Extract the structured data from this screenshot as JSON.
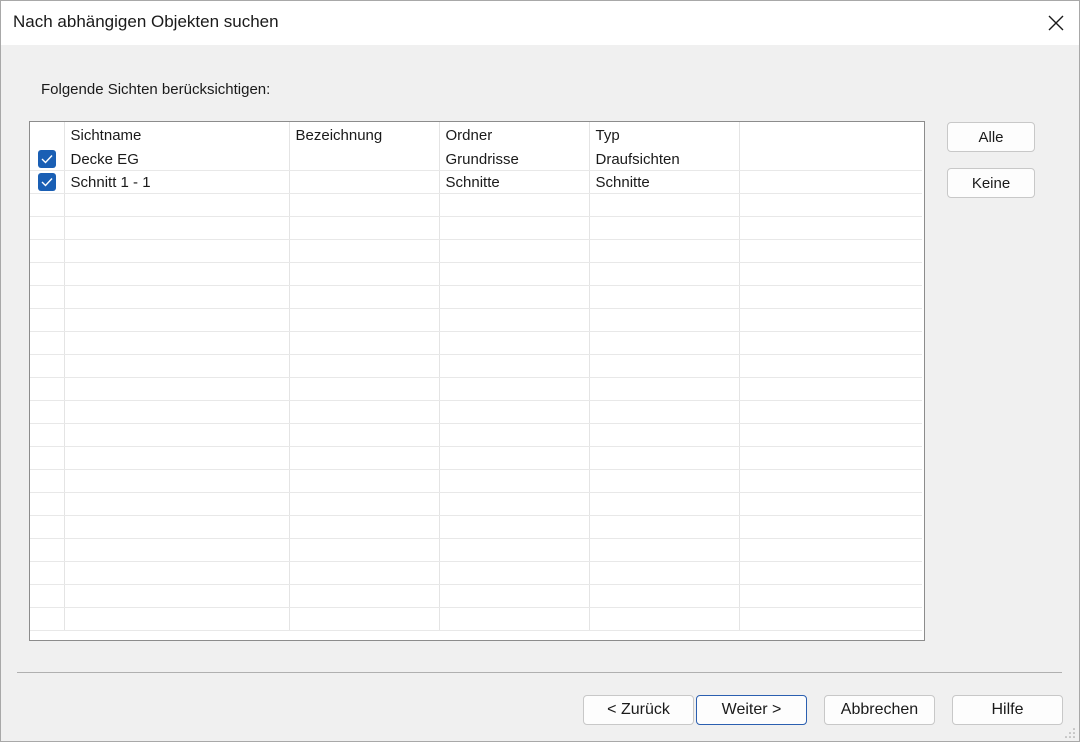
{
  "window": {
    "title": "Nach abhängigen Objekten suchen",
    "close_icon": "close-icon"
  },
  "prompt": "Folgende Sichten berücksichtigen:",
  "grid": {
    "columns": [
      "Sichtname",
      "Bezeichnung",
      "Ordner",
      "Typ"
    ],
    "rows": [
      {
        "checked": true,
        "name": "Decke EG",
        "designation": "",
        "folder": "Grundrisse",
        "type": "Draufsichten"
      },
      {
        "checked": true,
        "name": "Schnitt 1 - 1",
        "designation": "",
        "folder": "Schnitte",
        "type": "Schnitte"
      }
    ],
    "check_color": "#1a5fb4"
  },
  "side_buttons": {
    "all": "Alle",
    "none": "Keine"
  },
  "footer": {
    "back": "< Zurück",
    "next": "Weiter >",
    "cancel": "Abbrechen",
    "help": "Hilfe"
  }
}
